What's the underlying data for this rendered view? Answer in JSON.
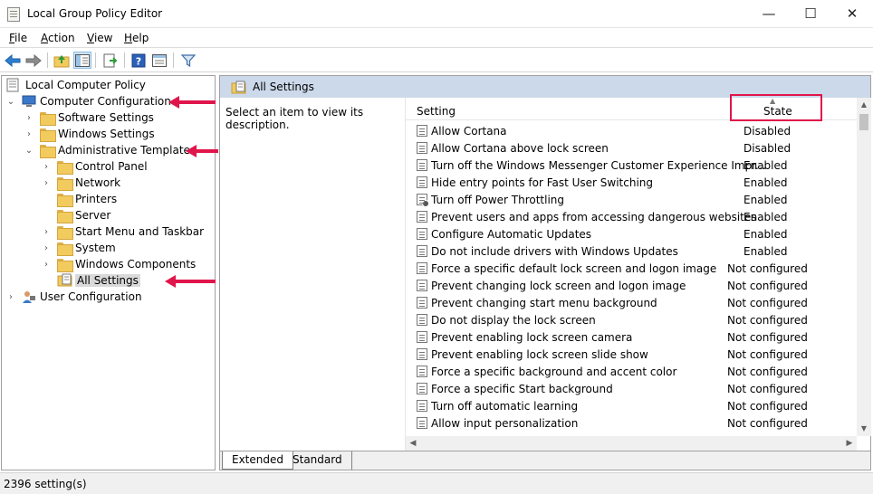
{
  "window": {
    "title": "Local Group Policy Editor",
    "min": "—",
    "max": "☐",
    "close": "✕"
  },
  "menu": {
    "file": "File",
    "action": "Action",
    "view": "View",
    "help": "Help"
  },
  "tree": {
    "root": "Local Computer Policy",
    "computer_config": "Computer Configuration",
    "software_settings": "Software Settings",
    "windows_settings": "Windows Settings",
    "admin_templates": "Administrative Templates",
    "control_panel": "Control Panel",
    "network": "Network",
    "printers": "Printers",
    "server": "Server",
    "start_menu": "Start Menu and Taskbar",
    "system": "System",
    "windows_components": "Windows Components",
    "all_settings": "All Settings",
    "user_config": "User Configuration"
  },
  "details": {
    "header_title": "All Settings",
    "description": "Select an item to view its description.",
    "col_setting": "Setting",
    "col_state": "State",
    "rows": [
      {
        "name": "Allow Cortana",
        "state": "Disabled"
      },
      {
        "name": "Allow Cortana above lock screen",
        "state": "Disabled"
      },
      {
        "name": "Turn off the Windows Messenger Customer Experience Impr...",
        "state": "Enabled"
      },
      {
        "name": "Hide entry points for Fast User Switching",
        "state": "Enabled"
      },
      {
        "name": "Turn off Power Throttling",
        "state": "Enabled"
      },
      {
        "name": "Prevent users and apps from accessing dangerous websites",
        "state": "Enabled"
      },
      {
        "name": "Configure Automatic Updates",
        "state": "Enabled"
      },
      {
        "name": "Do not include drivers with Windows Updates",
        "state": "Enabled"
      },
      {
        "name": "Force a specific default lock screen and logon image",
        "state": "Not configured"
      },
      {
        "name": "Prevent changing lock screen and logon image",
        "state": "Not configured"
      },
      {
        "name": "Prevent changing start menu background",
        "state": "Not configured"
      },
      {
        "name": "Do not display the lock screen",
        "state": "Not configured"
      },
      {
        "name": "Prevent enabling lock screen camera",
        "state": "Not configured"
      },
      {
        "name": "Prevent enabling lock screen slide show",
        "state": "Not configured"
      },
      {
        "name": "Force a specific background and accent color",
        "state": "Not configured"
      },
      {
        "name": "Force a specific Start background",
        "state": "Not configured"
      },
      {
        "name": "Turn off automatic learning",
        "state": "Not configured"
      },
      {
        "name": "Allow input personalization",
        "state": "Not configured"
      }
    ]
  },
  "tabs": {
    "extended": "Extended",
    "standard": "Standard"
  },
  "status": {
    "count": "2396 setting(s)"
  },
  "colors": {
    "annotation_red": "#e0154b",
    "header_blue": "#ccd9ea"
  }
}
